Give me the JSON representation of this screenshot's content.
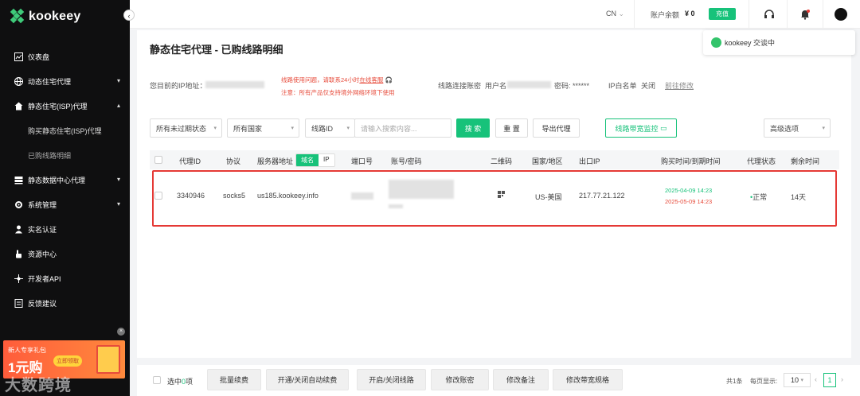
{
  "brand": {
    "name": "kookeey"
  },
  "sidebar": {
    "items": [
      {
        "label": "仪表盘",
        "icon": "dashboard-icon"
      },
      {
        "label": "动态住宅代理",
        "icon": "globe-icon",
        "caret": "⌄"
      },
      {
        "label": "静态住宅(ISP)代理",
        "icon": "home-icon",
        "caret": "⌃"
      },
      {
        "label": "购买静态住宅(ISP)代理",
        "icon": ""
      },
      {
        "label": "已购线路明细",
        "icon": ""
      },
      {
        "label": "静态数据中心代理",
        "icon": "server-icon",
        "caret": "⌄"
      },
      {
        "label": "系统管理",
        "icon": "gear-icon",
        "caret": "⌄"
      },
      {
        "label": "实名认证",
        "icon": "user-icon"
      },
      {
        "label": "资源中心",
        "icon": "hand-icon"
      },
      {
        "label": "开发者API",
        "icon": "api-icon"
      },
      {
        "label": "反馈建议",
        "icon": "feedback-icon"
      }
    ],
    "promo": {
      "title": "新人专享礼包",
      "big": "1元购",
      "button": "立即领取"
    },
    "watermark": "大数跨境"
  },
  "topbar": {
    "lang": "CN",
    "balance_label": "账户余额",
    "balance_value": "¥ 0",
    "recharge": "充值"
  },
  "chat": {
    "text": "kookeey 交谈中"
  },
  "page": {
    "title": "静态住宅代理 - 已购线路明细",
    "ip_label": "您目前的IP地址：",
    "warn_line1_a": "线路使用问题，请联系24小时",
    "warn_line1_link": "在线客服",
    "warn_line2": "注意：所有产品仅支持境外网络环境下使用",
    "conn_label": "线路连接账密",
    "user_label": "用户名",
    "pwd_label": "密码: ******",
    "whitelist_label": "IP白名单",
    "whitelist_value": "关闭",
    "whitelist_link": "前往修改"
  },
  "filters": {
    "status": "所有未过期状态",
    "country": "所有国家",
    "field": "线路ID",
    "search_placeholder": "请输入搜索内容...",
    "search_btn": "搜 索",
    "reset_btn": "重 置",
    "export_btn": "导出代理",
    "monitor_btn": "线路带宽监控",
    "advanced": "高级选项"
  },
  "table": {
    "headers": {
      "id": "代理ID",
      "protocol": "协议",
      "server": "服务器地址",
      "seg_domain": "域名",
      "seg_ip": "IP",
      "port": "端口号",
      "account": "账号/密码",
      "qr": "二维码",
      "country": "国家/地区",
      "exit_ip": "出口IP",
      "time": "购买时间/到期时间",
      "status": "代理状态",
      "remaining": "剩余时间"
    },
    "rows": [
      {
        "id": "3340946",
        "protocol": "socks5",
        "server": "us185.kookeey.info",
        "country": "US-美国",
        "exit_ip": "217.77.21.122",
        "purchase": "2025-04-09 14:23",
        "expire": "2025-05-09 14:23",
        "status": "正常",
        "remaining": "14天"
      }
    ]
  },
  "bottom": {
    "selected_prefix": "选中",
    "selected_count": "0",
    "selected_suffix": "项",
    "buttons": [
      "批量续费",
      "开通/关闭自动续费",
      "开启/关闭线路",
      "修改账密",
      "修改备注",
      "修改带宽规格"
    ],
    "total": "共1条",
    "per_page_label": "每页显示:",
    "per_page": "10",
    "current_page": "1"
  },
  "colors": {
    "accent": "#17c27a",
    "danger": "#e53935",
    "sidebar_bg": "#0f0f10"
  }
}
